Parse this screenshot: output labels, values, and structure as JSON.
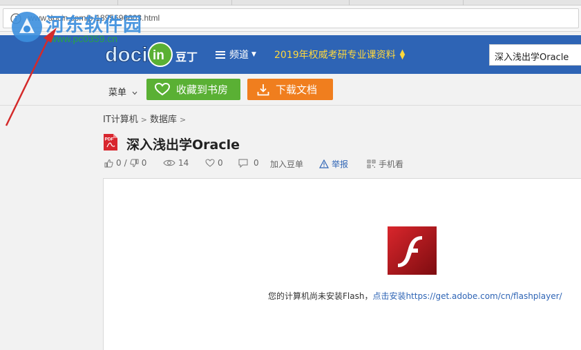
{
  "browser": {
    "url": "www.docin.com/p-1895696603.html"
  },
  "watermark": {
    "site_name": "河东软件园",
    "site_url": "www.pc0359.cn"
  },
  "header": {
    "logo_text": "docin",
    "logo_sub": "豆丁",
    "channel_label": "频道",
    "promo_text": "2019年权威考研专业课资料",
    "search_value": "深入浅出学Oracle"
  },
  "toolbar": {
    "menu_label": "菜单",
    "favorite_label": "收藏到书房",
    "download_label": "下载文档"
  },
  "breadcrumb": [
    "IT计算机",
    "数据库"
  ],
  "document": {
    "title": "深入浅出学Oracle",
    "likes": "0",
    "dislikes": "0",
    "views": "14",
    "favorites": "0",
    "comments": "0",
    "add_to_list": "加入豆单",
    "report": "举报",
    "mobile_view": "手机看"
  },
  "viewer": {
    "message": "您的计算机尚未安装Flash，",
    "install_link": "点击安装https://get.adobe.com/cn/flashplayer/"
  },
  "colors": {
    "nav_blue": "#2e64b5",
    "promo_yellow": "#ffd83c",
    "fav_green": "#5ab034",
    "download_orange": "#f07e1e",
    "flash_red": "#c4161c"
  }
}
